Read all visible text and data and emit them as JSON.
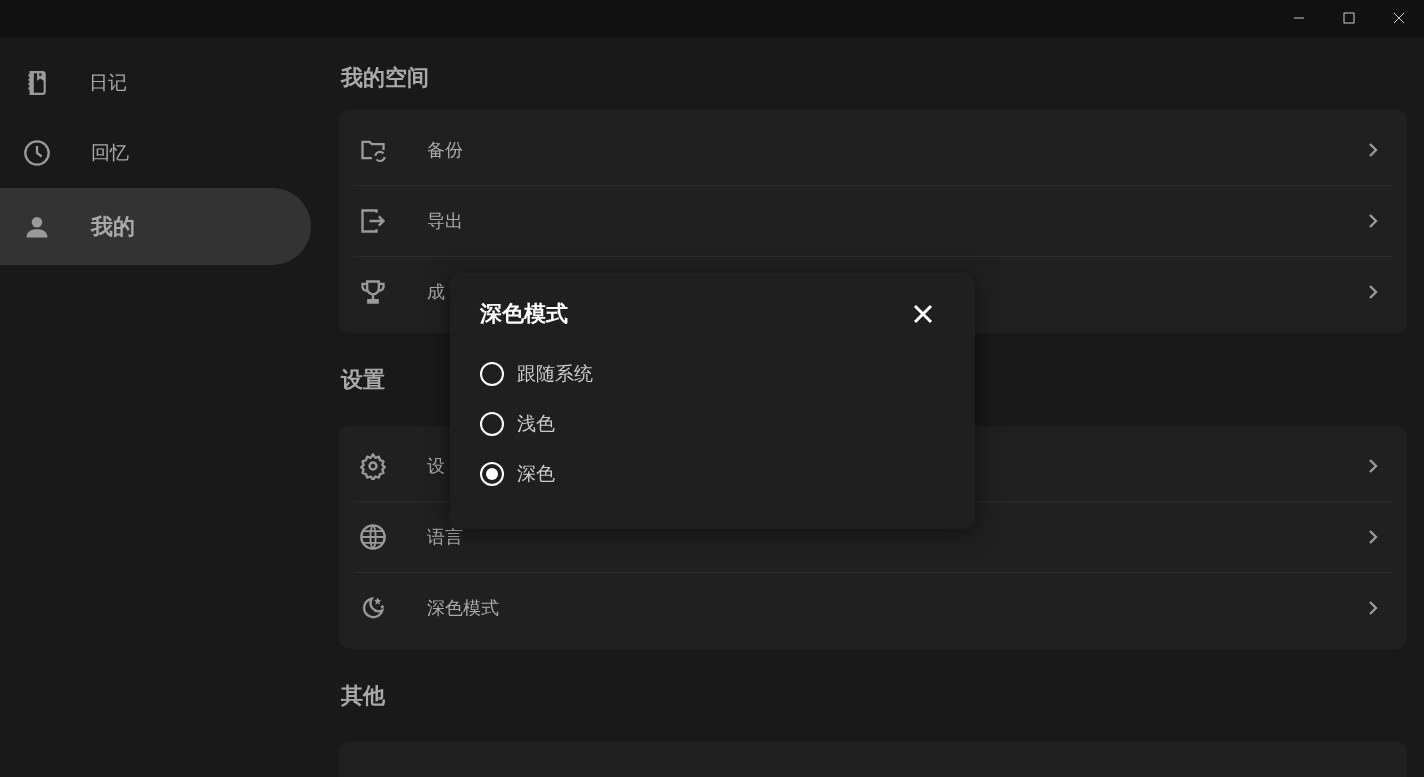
{
  "sidebar": {
    "items": [
      {
        "label": "日记",
        "selected": false
      },
      {
        "label": "回忆",
        "selected": false
      },
      {
        "label": "我的",
        "selected": true
      }
    ]
  },
  "sections": [
    {
      "title": "我的空间",
      "items": [
        {
          "label": "备份"
        },
        {
          "label": "导出"
        },
        {
          "label": "成"
        }
      ]
    },
    {
      "title": "设置",
      "items": [
        {
          "label": "设"
        },
        {
          "label": "语言"
        },
        {
          "label": "深色模式"
        }
      ]
    },
    {
      "title": "其他"
    }
  ],
  "dialog": {
    "title": "深色模式",
    "options": [
      {
        "label": "跟随系统",
        "selected": false
      },
      {
        "label": "浅色",
        "selected": false
      },
      {
        "label": "深色",
        "selected": true
      }
    ]
  }
}
